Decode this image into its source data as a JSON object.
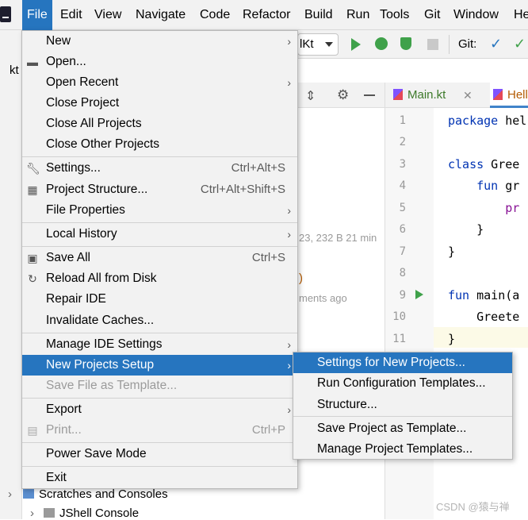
{
  "menubar": {
    "items": [
      "File",
      "Edit",
      "View",
      "Navigate",
      "Code",
      "Refactor",
      "Build",
      "Run",
      "Tools",
      "Git",
      "Window",
      "He"
    ]
  },
  "toolbar": {
    "run_config": "lKt",
    "git_label": "Git:"
  },
  "project_panel": {
    "tab_label": "kt",
    "bg_text_1": "23, 232 B 21 min",
    "bg_paren": ")",
    "bg_text_2": "ments ago"
  },
  "editor": {
    "tabs": [
      {
        "label": "Main.kt"
      },
      {
        "label": "Hell"
      }
    ],
    "line_numbers": [
      "1",
      "2",
      "3",
      "4",
      "5",
      "6",
      "7",
      "8",
      "9",
      "10",
      "11"
    ],
    "lines": [
      {
        "kw": "package",
        "rest": " hel"
      },
      {
        "kw": "",
        "rest": ""
      },
      {
        "kw": "class",
        "rest": " Gree"
      },
      {
        "kw": "    fun",
        "rest": " gr"
      },
      {
        "kw": "",
        "rest": "        pr"
      },
      {
        "kw": "",
        "rest": "    }"
      },
      {
        "kw": "",
        "rest": "}"
      },
      {
        "kw": "",
        "rest": ""
      },
      {
        "kw": "fun",
        "rest": " main(a"
      },
      {
        "kw": "",
        "rest": "    Greete"
      },
      {
        "kw": "",
        "rest": "}"
      }
    ]
  },
  "file_menu": {
    "items": [
      {
        "label": "New",
        "shortcut": "",
        "submenu": true
      },
      {
        "label": "Open...",
        "shortcut": "",
        "submenu": false
      },
      {
        "label": "Open Recent",
        "shortcut": "",
        "submenu": true
      },
      {
        "label": "Close Project",
        "shortcut": "",
        "submenu": false
      },
      {
        "label": "Close All Projects",
        "shortcut": "",
        "submenu": false
      },
      {
        "label": "Close Other Projects",
        "shortcut": "",
        "submenu": false
      },
      {
        "label": "Settings...",
        "shortcut": "Ctrl+Alt+S",
        "submenu": false
      },
      {
        "label": "Project Structure...",
        "shortcut": "Ctrl+Alt+Shift+S",
        "submenu": false
      },
      {
        "label": "File Properties",
        "shortcut": "",
        "submenu": true
      },
      {
        "label": "Local History",
        "shortcut": "",
        "submenu": true
      },
      {
        "label": "Save All",
        "shortcut": "Ctrl+S",
        "submenu": false
      },
      {
        "label": "Reload All from Disk",
        "shortcut": "",
        "submenu": false
      },
      {
        "label": "Repair IDE",
        "shortcut": "",
        "submenu": false
      },
      {
        "label": "Invalidate Caches...",
        "shortcut": "",
        "submenu": false
      },
      {
        "label": "Manage IDE Settings",
        "shortcut": "",
        "submenu": true
      },
      {
        "label": "New Projects Setup",
        "shortcut": "",
        "submenu": true
      },
      {
        "label": "Save File as Template...",
        "shortcut": "",
        "submenu": false
      },
      {
        "label": "Export",
        "shortcut": "",
        "submenu": true
      },
      {
        "label": "Print...",
        "shortcut": "Ctrl+P",
        "submenu": false
      },
      {
        "label": "Power Save Mode",
        "shortcut": "",
        "submenu": false
      },
      {
        "label": "Exit",
        "shortcut": "",
        "submenu": false
      }
    ]
  },
  "submenu": {
    "items": [
      {
        "label": "Settings for New Projects..."
      },
      {
        "label": "Run Configuration Templates..."
      },
      {
        "label": "Structure..."
      },
      {
        "label": "Save Project as Template..."
      },
      {
        "label": "Manage Project Templates..."
      }
    ]
  },
  "tree": {
    "scratches": "Scratches and Consoles",
    "jshell": "JShell Console"
  },
  "watermark": "CSDN @猿与禅",
  "colors": {
    "accent": "#2675bf",
    "run_green": "#3fa14a",
    "keyword": "#0033b3"
  }
}
